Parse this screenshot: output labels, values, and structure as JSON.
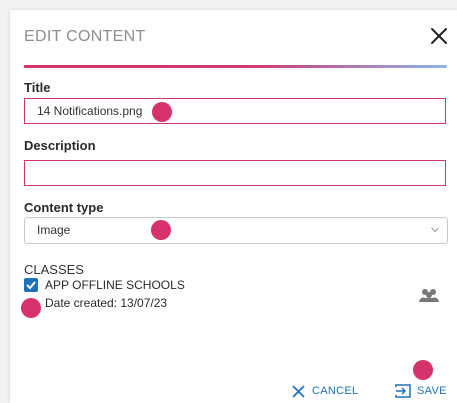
{
  "dialog": {
    "title": "EDIT CONTENT",
    "close_icon": "close-icon",
    "accent_gradient": [
      "#d8326b",
      "#8db5e7"
    ]
  },
  "form": {
    "title_label": "Title",
    "title_value": "14 Notifications.png",
    "description_label": "Description",
    "description_value": "",
    "content_type_label": "Content type",
    "content_type_value": "Image"
  },
  "classes": {
    "heading": "CLASSES",
    "items": [
      {
        "name": "APP OFFLINE SCHOOLS",
        "date": "Date created: 13/07/23",
        "checked": true
      }
    ]
  },
  "actions": {
    "cancel_label": "CANCEL",
    "save_label": "SAVE",
    "accent": "#1f71b8"
  },
  "markers": {
    "color": "#d6336d"
  }
}
